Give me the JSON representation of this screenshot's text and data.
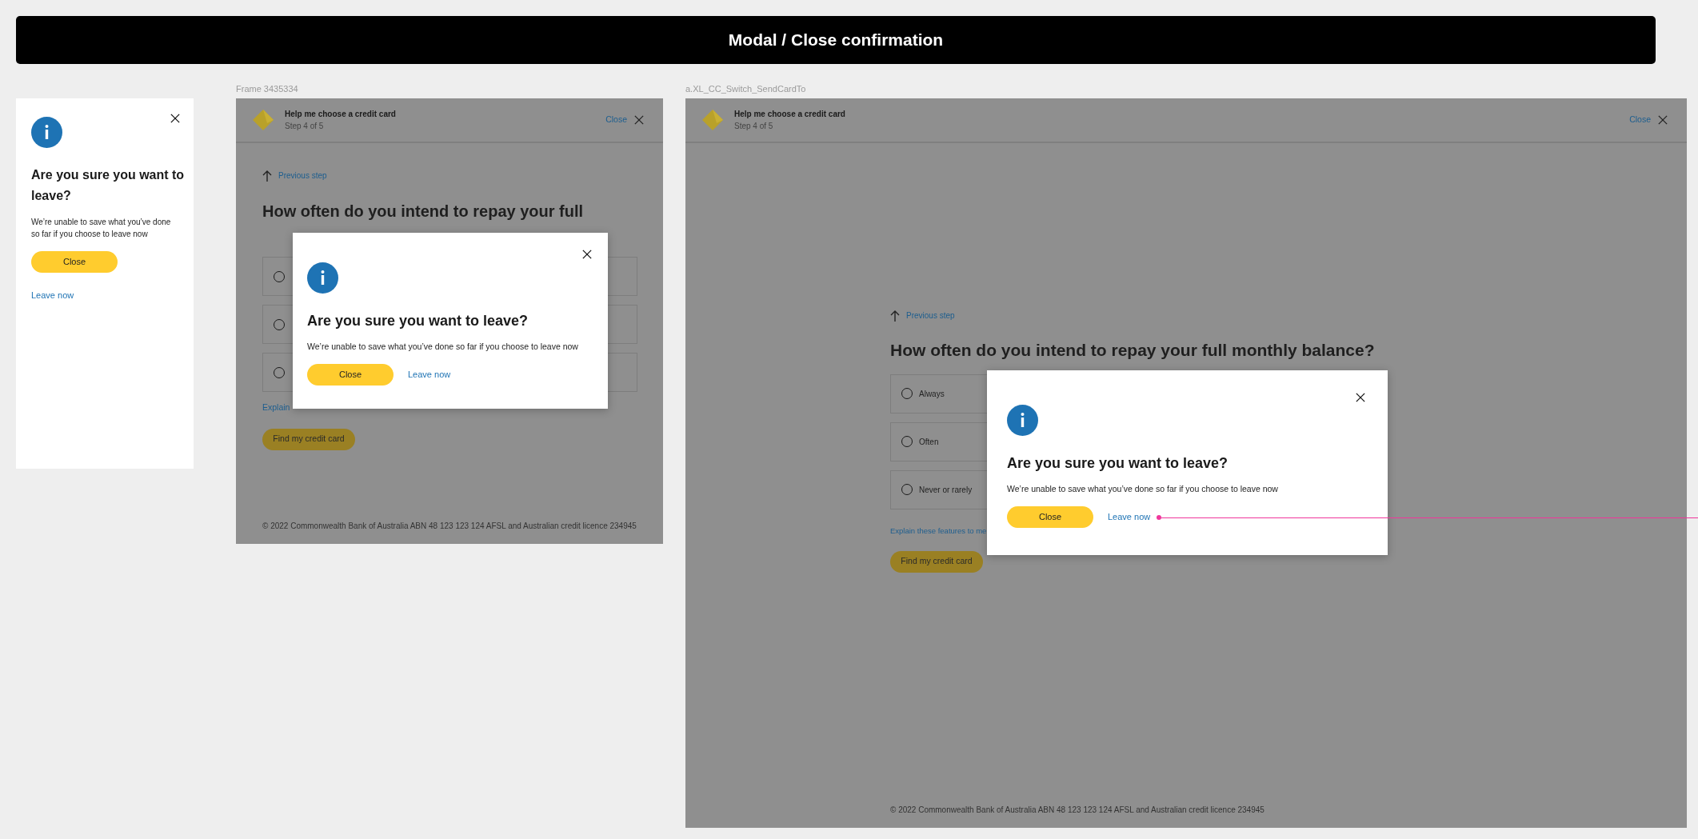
{
  "page_title": "Modal / Close confirmation",
  "mobile_modal": {
    "title": "Are you sure you want to leave?",
    "body": "We’re unable to save what you’ve done so far if you choose to leave now",
    "primary_button": "Close",
    "link": "Leave now"
  },
  "frames": [
    {
      "label": "Frame 3435334",
      "header": {
        "title": "Help me choose a credit card",
        "step": "Step 4 of 5",
        "close": "Close"
      },
      "previous_step": "Previous step",
      "question": "How often do you intend to repay your full",
      "options": [
        {
          "selected": false
        },
        {
          "selected": false
        },
        {
          "selected": false
        }
      ],
      "explain_link": "Explain",
      "find_button": "Find my credit card",
      "footer": "© 2022 Commonwealth Bank of Australia ABN 48 123 123 124 AFSL and Australian credit licence 234945",
      "modal": {
        "title": "Are you sure you want to leave?",
        "body": "We’re unable to save what you’ve done so far if you choose to leave now",
        "primary_button": "Close",
        "link": "Leave now"
      }
    },
    {
      "label": "a.XL_CC_Switch_SendCardTo",
      "header": {
        "title": "Help me choose a credit card",
        "step": "Step 4 of 5",
        "close": "Close"
      },
      "previous_step": "Previous step",
      "question": "How often do you intend to repay your full monthly balance?",
      "options": [
        {
          "label": "Always",
          "selected": false
        },
        {
          "label": "Often",
          "selected": false
        },
        {
          "label": "Never or rarely",
          "selected": false
        }
      ],
      "explain_link": "Explain these features to me",
      "find_button": "Find my credit card",
      "footer": "© 2022 Commonwealth Bank of Australia ABN 48 123 123 124 AFSL and Australian credit licence 234945",
      "modal": {
        "title": "Are you sure you want to leave?",
        "body": "We’re unable to save what you’ve done so far if you choose to leave now",
        "primary_button": "Close",
        "link": "Leave now"
      }
    }
  ]
}
